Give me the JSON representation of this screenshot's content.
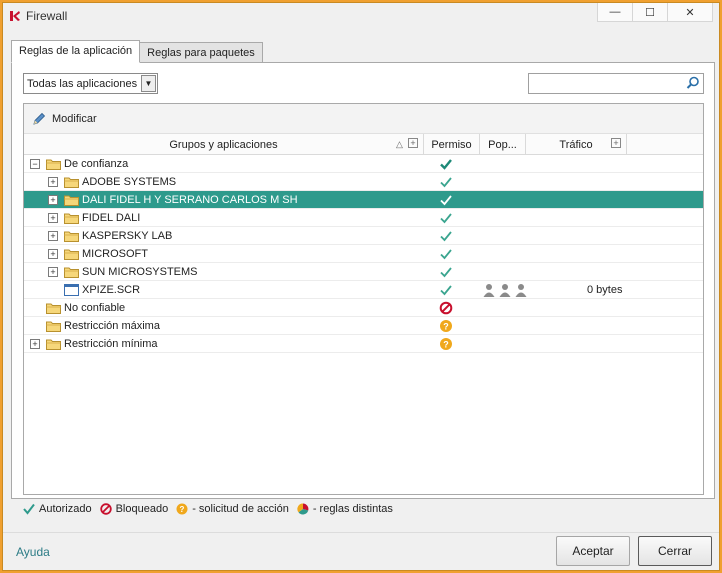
{
  "window": {
    "title": "Firewall",
    "minimize": "—",
    "maximize": "☐",
    "close": "✕"
  },
  "tabs": [
    {
      "label": "Reglas de la aplicación",
      "active": true
    },
    {
      "label": "Reglas para paquetes",
      "active": false
    }
  ],
  "filter": {
    "selected": "Todas las aplicaciones"
  },
  "search": {
    "placeholder": "",
    "value": ""
  },
  "toolbar": {
    "modify_label": "Modificar"
  },
  "columns": {
    "groups": "Grupos y aplicaciones",
    "permission": "Permiso",
    "pop": "Pop...",
    "traffic": "Tráfico",
    "sort_marker": "△",
    "add_marker": "+"
  },
  "rows": [
    {
      "label": "De confianza",
      "level": 0,
      "expander": "−",
      "icon": "folder-icon",
      "permission": "allowed-strong",
      "selected": false
    },
    {
      "label": "ADOBE SYSTEMS",
      "level": 1,
      "expander": "+",
      "icon": "folder-icon",
      "permission": "allowed",
      "selected": false
    },
    {
      "label": "DALI FIDEL H Y SERRANO CARLOS M SH",
      "level": 1,
      "expander": "+",
      "icon": "folder-icon",
      "permission": "allowed",
      "selected": true
    },
    {
      "label": "FIDEL DALI",
      "level": 1,
      "expander": "+",
      "icon": "folder-icon",
      "permission": "allowed",
      "selected": false
    },
    {
      "label": "KASPERSKY LAB",
      "level": 1,
      "expander": "+",
      "icon": "folder-icon",
      "permission": "allowed",
      "selected": false
    },
    {
      "label": "MICROSOFT",
      "level": 1,
      "expander": "+",
      "icon": "folder-icon",
      "permission": "allowed",
      "selected": false
    },
    {
      "label": "SUN MICROSYSTEMS",
      "level": 1,
      "expander": "+",
      "icon": "folder-icon",
      "permission": "allowed",
      "selected": false
    },
    {
      "label": "XPIZE.SCR",
      "level": 1,
      "expander": "",
      "icon": "application-icon",
      "permission": "allowed",
      "selected": false,
      "traffic": "0 bytes",
      "users": 3
    },
    {
      "label": "No confiable",
      "level": 0,
      "expander": "",
      "icon": "folder-icon",
      "permission": "blocked",
      "selected": false
    },
    {
      "label": "Restricción máxima",
      "level": 0,
      "expander": "",
      "icon": "folder-icon",
      "permission": "ask",
      "selected": false
    },
    {
      "label": "Restricción mínima",
      "level": 0,
      "expander": "+",
      "icon": "folder-icon",
      "permission": "ask",
      "selected": false
    }
  ],
  "legend": {
    "allowed": "Autorizado",
    "blocked": "Bloqueado",
    "ask": "- solicitud de acción",
    "mixed": "- reglas distintas"
  },
  "footer": {
    "help": "Ayuda",
    "accept": "Aceptar",
    "close": "Cerrar"
  },
  "colors": {
    "accent": "#2e9a8c",
    "allowed": "#3aa58f",
    "blocked": "#c8102e",
    "ask": "#f0a81c",
    "frame": "#f0a030"
  }
}
